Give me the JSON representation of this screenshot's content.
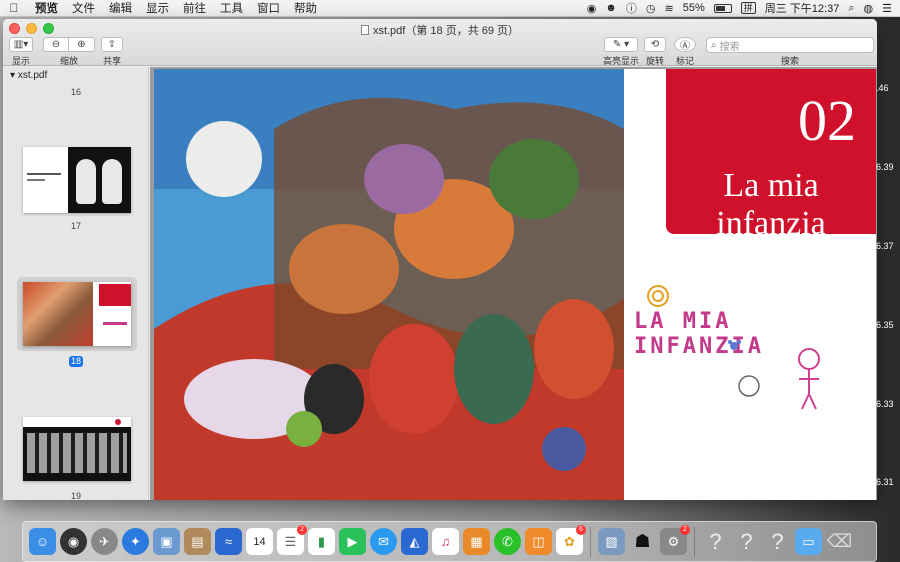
{
  "menubar": {
    "app_name": "预览",
    "items": [
      "文件",
      "编辑",
      "显示",
      "前往",
      "工具",
      "窗口",
      "帮助"
    ],
    "battery": "55%",
    "input_method": "拼",
    "clock": "周三 下午12:37"
  },
  "window": {
    "title": "xst.pdf（第 18 页，共 69 页）"
  },
  "toolbar": {
    "view_label": "显示",
    "zoom_label": "缩放",
    "share_label": "共享",
    "highlight_label": "高亮显示",
    "rotate_label": "旋转",
    "markup_label": "标记",
    "search_label": "搜索",
    "search_placeholder": "搜索"
  },
  "sidebar": {
    "file_name": "xst.pdf",
    "pages": [
      "16",
      "17",
      "18",
      "19"
    ],
    "selected_page": "18"
  },
  "document": {
    "chapter_number": "02",
    "chapter_title": "La mia infanzia",
    "crayon_title": "LA MIA INFANZIA"
  },
  "right_strip_values": [
    ".46",
    "6.39",
    "6.37",
    "6.35",
    "6.33",
    "6.31"
  ],
  "dock": {
    "icons": [
      "finder-icon",
      "siri-icon",
      "launchpad-icon",
      "safari-icon",
      "preview-icon",
      "notes-icon",
      "whale-icon",
      "calendar-icon",
      "reminders-icon",
      "numbers-icon",
      "facetime-icon",
      "messages-icon",
      "keynote-icon",
      "music-icon",
      "reader-icon",
      "wechat-icon",
      "books-icon",
      "photos-icon",
      "preview-doc-icon",
      "qq-icon",
      "system-prefs-icon",
      "unknown-icon",
      "unknown-icon",
      "unknown-icon",
      "folder-icon",
      "trash-icon"
    ],
    "calendar_day": "14",
    "badges": {
      "reminders": "2",
      "photos": "6",
      "system_prefs": "2"
    }
  }
}
